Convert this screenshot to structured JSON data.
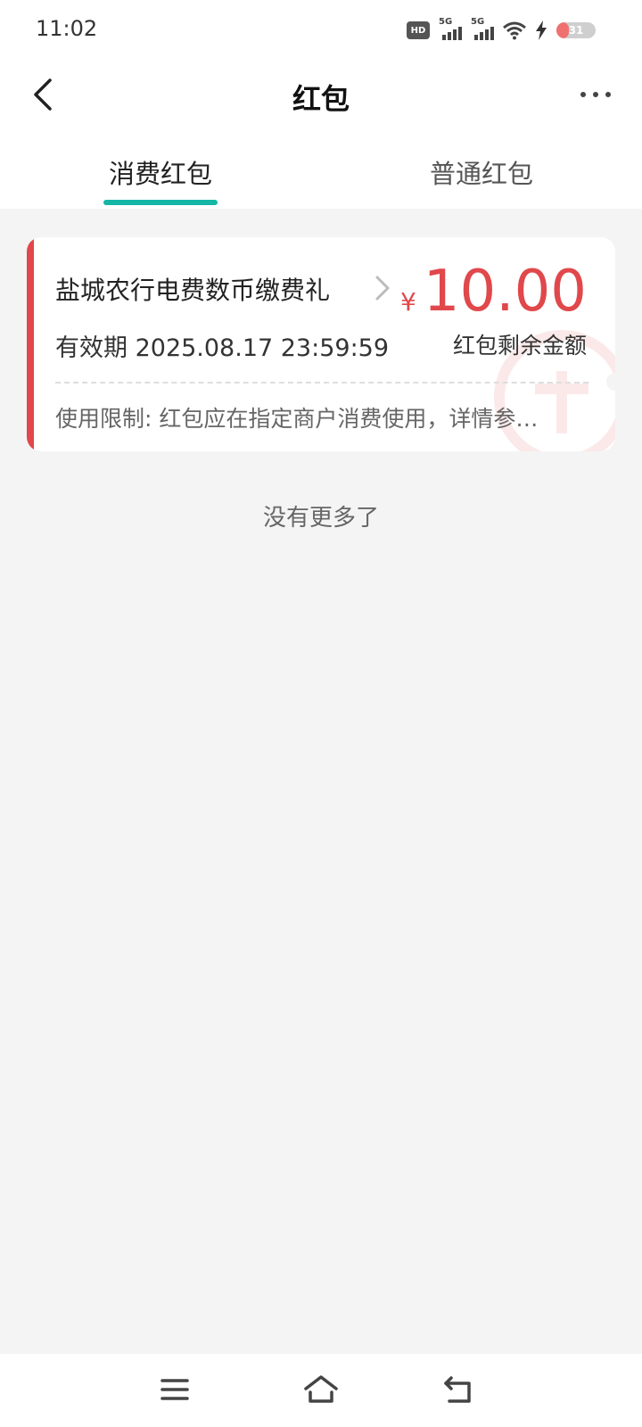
{
  "status_bar": {
    "time": "11:02",
    "hd_label": "HD",
    "signal1_label": "5G",
    "signal2_label": "5G",
    "battery_level": "31",
    "battery_fraction": 0.31
  },
  "header": {
    "title": "红包"
  },
  "tabs": [
    {
      "label": "消费红包",
      "active": true
    },
    {
      "label": "普通红包",
      "active": false
    }
  ],
  "card": {
    "title": "盐城农行电费数币缴费礼",
    "validity": "有效期 2025.08.17 23:59:59",
    "currency": "¥",
    "amount": "10.00",
    "amount_label": "红包剩余金额",
    "limit_text": "使用限制: 红包应在指定商户消费使用，详情参…",
    "accent_color": "#e0484b"
  },
  "footer_text": "没有更多了",
  "colors": {
    "tab_indicator": "#15b6a6",
    "amount": "#e0484b",
    "background": "#f4f4f4"
  },
  "icons": {
    "back": "chevron-left-icon",
    "more": "more-dots-icon",
    "card_chevron": "chevron-right-icon",
    "menu": "menu-icon",
    "home": "home-icon",
    "back_nav": "back-arrow-icon"
  }
}
